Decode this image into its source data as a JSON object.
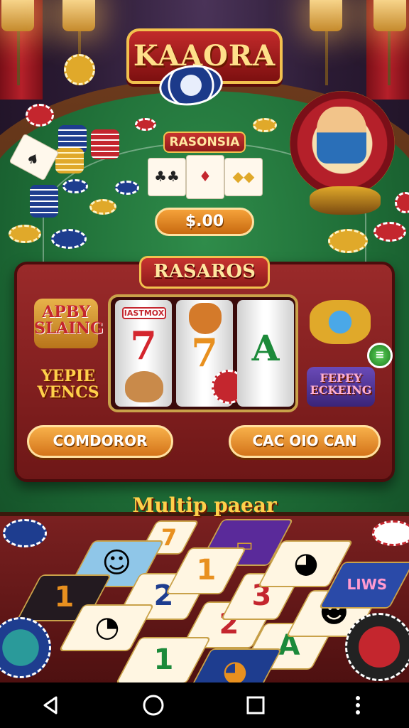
{
  "logo": {
    "title": "KAAORA"
  },
  "dealer": {
    "label": "RASONSIA",
    "bet_amount": "$.00"
  },
  "slot": {
    "title": "RASAROS",
    "reel_top_label": "IASTMOX",
    "left_badges": [
      "APBY SLAING",
      "YEPIE VENCS"
    ],
    "right_badges": [
      "FEPEY ECKEING"
    ],
    "symbols": [
      "7",
      "7",
      "A"
    ],
    "buttons": {
      "left": "COMDOROR",
      "right": "CAC OIO CAN"
    },
    "menu_icon": "≡"
  },
  "multiplayer": {
    "title": "Multip paear",
    "tiles": [
      "7",
      "1",
      "2",
      "1",
      "2",
      "3",
      "1",
      "A",
      "LIWS"
    ]
  },
  "colors": {
    "felt": "#1d6a35",
    "panel": "#8a2020",
    "gold": "#f2c14e",
    "button": "#e8901f"
  },
  "navbar": {
    "icons": [
      "back-icon",
      "home-icon",
      "recents-icon",
      "more-icon"
    ]
  }
}
